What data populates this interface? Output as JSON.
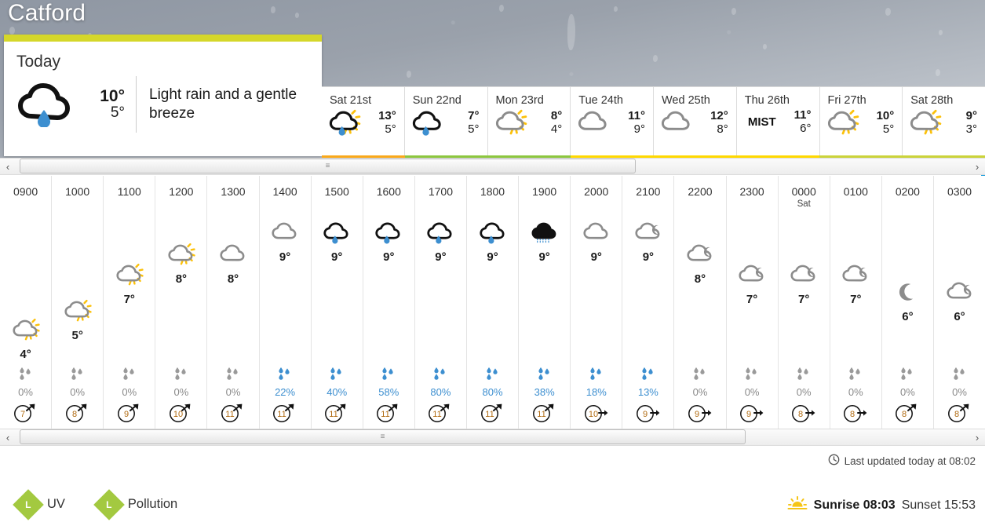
{
  "location": {
    "name": "Catford"
  },
  "today": {
    "label": "Today",
    "icon": "cloud-rain-icon",
    "high": "10°",
    "low": "5°",
    "description": "Light rain and a gentle breeze"
  },
  "days": [
    {
      "name": "Sat 21st",
      "icon": "sun-cloud-rain-icon",
      "high": "13°",
      "low": "5°",
      "bar_color": "#f9a81a"
    },
    {
      "name": "Sun 22nd",
      "icon": "cloud-rain-icon",
      "high": "7°",
      "low": "5°",
      "bar_color": "#8cc63e"
    },
    {
      "name": "Mon 23rd",
      "icon": "sun-cloud-icon",
      "high": "8°",
      "low": "4°",
      "bar_color": "#8cc63e"
    },
    {
      "name": "Tue 24th",
      "icon": "cloud-icon",
      "high": "11°",
      "low": "9°",
      "bar_color": "#ffd800"
    },
    {
      "name": "Wed 25th",
      "icon": "cloud-icon",
      "high": "12°",
      "low": "8°",
      "bar_color": "#ffd800"
    },
    {
      "name": "Thu 26th",
      "icon": "mist-text",
      "text": "MIST",
      "high": "11°",
      "low": "6°",
      "bar_color": "#ffd800"
    },
    {
      "name": "Fri 27th",
      "icon": "sun-cloud-icon",
      "high": "10°",
      "low": "5°",
      "bar_color": "#cbd33a"
    },
    {
      "name": "Sat 28th",
      "icon": "sun-cloud-icon",
      "high": "9°",
      "low": "3°",
      "bar_color": "#cbd33a"
    }
  ],
  "hourly": [
    {
      "time": "0900",
      "daymark": "",
      "icon": "sun-cloud-icon",
      "temp": "4°",
      "level": 0,
      "precip": "0%",
      "wind": "7",
      "wind_dir": "ne"
    },
    {
      "time": "1000",
      "daymark": "",
      "icon": "sun-cloud-icon",
      "temp": "5°",
      "level": 1,
      "precip": "0%",
      "wind": "8",
      "wind_dir": "ne"
    },
    {
      "time": "1100",
      "daymark": "",
      "icon": "sun-cloud-icon",
      "temp": "7°",
      "level": 3,
      "precip": "0%",
      "wind": "9",
      "wind_dir": "ne"
    },
    {
      "time": "1200",
      "daymark": "",
      "icon": "sun-cloud-icon",
      "temp": "8°",
      "level": 4,
      "precip": "0%",
      "wind": "10",
      "wind_dir": "ne"
    },
    {
      "time": "1300",
      "daymark": "",
      "icon": "cloud-icon",
      "temp": "8°",
      "level": 4,
      "precip": "0%",
      "wind": "11",
      "wind_dir": "ne"
    },
    {
      "time": "1400",
      "daymark": "",
      "icon": "cloud-icon",
      "temp": "9°",
      "level": 5,
      "precip": "22%",
      "wind": "11",
      "wind_dir": "ne"
    },
    {
      "time": "1500",
      "daymark": "",
      "icon": "cloud-rain-icon",
      "temp": "9°",
      "level": 5,
      "precip": "40%",
      "wind": "11",
      "wind_dir": "ne"
    },
    {
      "time": "1600",
      "daymark": "",
      "icon": "cloud-rain-icon",
      "temp": "9°",
      "level": 5,
      "precip": "58%",
      "wind": "11",
      "wind_dir": "ne"
    },
    {
      "time": "1700",
      "daymark": "",
      "icon": "cloud-rain-icon",
      "temp": "9°",
      "level": 5,
      "precip": "80%",
      "wind": "11",
      "wind_dir": "ne"
    },
    {
      "time": "1800",
      "daymark": "",
      "icon": "cloud-rain-icon",
      "temp": "9°",
      "level": 5,
      "precip": "80%",
      "wind": "11",
      "wind_dir": "ne"
    },
    {
      "time": "1900",
      "daymark": "",
      "icon": "cloud-drizzle-icon",
      "temp": "9°",
      "level": 5,
      "precip": "38%",
      "wind": "11",
      "wind_dir": "ne"
    },
    {
      "time": "2000",
      "daymark": "",
      "icon": "cloud-icon",
      "temp": "9°",
      "level": 5,
      "precip": "18%",
      "wind": "10",
      "wind_dir": "e"
    },
    {
      "time": "2100",
      "daymark": "",
      "icon": "moon-cloud-icon",
      "temp": "9°",
      "level": 5,
      "precip": "13%",
      "wind": "9",
      "wind_dir": "e"
    },
    {
      "time": "2200",
      "daymark": "",
      "icon": "moon-cloud-icon",
      "temp": "8°",
      "level": 4,
      "precip": "0%",
      "wind": "9",
      "wind_dir": "e"
    },
    {
      "time": "2300",
      "daymark": "",
      "icon": "moon-cloud-icon",
      "temp": "7°",
      "level": 3,
      "precip": "0%",
      "wind": "9",
      "wind_dir": "e"
    },
    {
      "time": "0000",
      "daymark": "Sat",
      "icon": "moon-cloud-icon",
      "temp": "7°",
      "level": 3,
      "precip": "0%",
      "wind": "8",
      "wind_dir": "e"
    },
    {
      "time": "0100",
      "daymark": "",
      "icon": "moon-cloud-icon",
      "temp": "7°",
      "level": 3,
      "precip": "0%",
      "wind": "8",
      "wind_dir": "e"
    },
    {
      "time": "0200",
      "daymark": "",
      "icon": "moon-icon",
      "temp": "6°",
      "level": 2,
      "precip": "0%",
      "wind": "8",
      "wind_dir": "ne"
    },
    {
      "time": "0300",
      "daymark": "",
      "icon": "moon-cloud-icon",
      "temp": "6°",
      "level": 2,
      "precip": "0%",
      "wind": "8",
      "wind_dir": "ne"
    }
  ],
  "footer": {
    "last_updated": "Last updated today at 08:02",
    "clock_icon": "clock-icon",
    "uv": {
      "label": "UV",
      "level": "L",
      "color": "#a3c940"
    },
    "pollution": {
      "label": "Pollution",
      "level": "L",
      "color": "#a3c940"
    },
    "sunrise_label": "Sunrise 08:03",
    "sunset_label": "Sunset 15:53",
    "sun_icon": "sunrise-icon"
  },
  "scrollbars": {
    "left_arrow": "‹",
    "right_arrow": "›",
    "grip": "≡"
  }
}
